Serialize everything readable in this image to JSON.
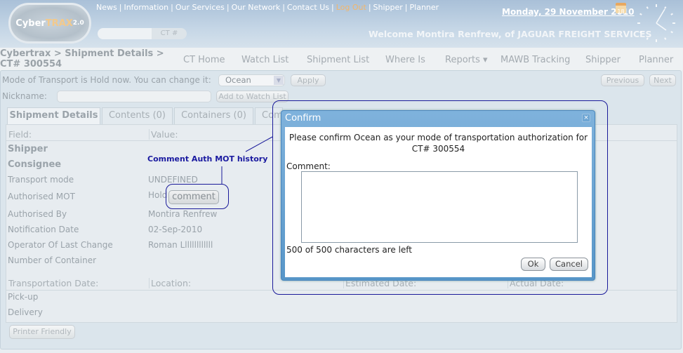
{
  "header": {
    "logo_text": "Cyber",
    "logo_accent": "TRAX",
    "logo_version": "2.0",
    "links": [
      "News",
      "Information",
      "Our Services",
      "Our Network",
      "Contact Us",
      "Log Out",
      "Shipper",
      "Planner"
    ],
    "ct_button": "CT #",
    "ct_input_value": "",
    "date": "Monday, 29 November 2010",
    "calendar_day": "18",
    "welcome": "Welcome Montira Renfrew, of JAGUAR FREIGHT SERVICES"
  },
  "breadcrumb": "Cybertrax > Shipment Details > CT# 300554",
  "nav": [
    "CT Home",
    "Watch List",
    "Shipment List",
    "Where Is",
    "Reports ▾",
    "MAWB Tracking",
    "Shipper",
    "Planner"
  ],
  "controls": {
    "mot_label": "Mode of Transport is Hold now. You can change it:",
    "mot_value": "Ocean",
    "apply": "Apply",
    "previous": "Previous",
    "next": "Next",
    "nickname_label": "Nickname:",
    "nickname_value": "",
    "add_watch": "Add to Watch List"
  },
  "tabs": [
    "Shipment Details",
    "Contents (0)",
    "Containers (0)",
    "Com"
  ],
  "details": {
    "field_header": "Field:",
    "value_header": "Value:",
    "rows": [
      {
        "field": "Shipper",
        "value": ""
      },
      {
        "field": "Consignee",
        "value": ""
      },
      {
        "field": "Transport mode",
        "value": "UNDEFINED"
      },
      {
        "field": "Authorised MOT",
        "value": "Hold"
      },
      {
        "field": "Authorised By",
        "value": "Montira Renfrew"
      },
      {
        "field": "Notification Date",
        "value": "02-Sep-2010"
      },
      {
        "field": "Operator Of Last Change",
        "value": "Roman Lllllllllllll"
      },
      {
        "field": "Number of Container",
        "value": ""
      }
    ],
    "comment_button": "comment"
  },
  "transport": {
    "headers": [
      "Transportation Date:",
      "Location:",
      "Estimated Date:",
      "Actual Date:"
    ],
    "rows": [
      "Pick-up",
      "Delivery"
    ]
  },
  "printer_friendly": "Printer Friendly",
  "annotation": "Comment Auth MOT history",
  "dialog": {
    "title": "Confirm",
    "close": "×",
    "message": "Please confirm Ocean as your mode of transportation authorization for CT# 300554",
    "comment_label": "Comment:",
    "comment_value": "",
    "count": "500 of 500 characters are left",
    "ok": "Ok",
    "cancel": "Cancel"
  },
  "colors": {
    "dialog_title": "#5796c8",
    "annotation": "#1a1aa0",
    "logout": "#f2b66b"
  }
}
